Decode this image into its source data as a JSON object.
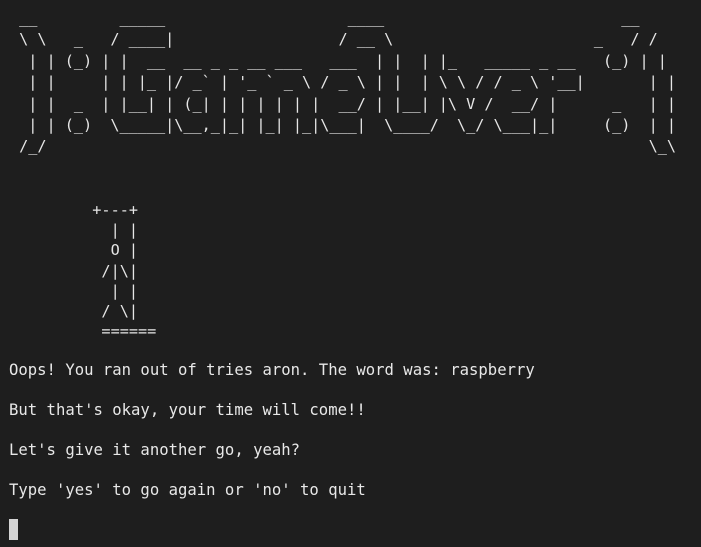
{
  "terminal": {
    "banner_art": " __         _____                    ____                          __\n \\ \\   _   / ____|                  / __ \\                      _   / /\n  | | (_) | |  __  __ _ _ __ ___   ___  | |  | |_   _____ _ __   (_) | |\n  | |     | | |_ |/ _` | '_ ` _ \\ / _ \\ | |  | \\ \\ / / _ \\ '__|       | |\n  | |  _  | |__| | (_| | | | | | |  __/ | |__| |\\ V /  __/ |      _   | |\n  | | (_)  \\_____|\\__,_|_| |_| |_|\\___|  \\____/  \\_/ \\___|_|     (_)  | |\n /_/                                                                  \\_\\",
    "gallows_art": "         +---+\n           | |\n           O |\n          /|\\|\n           | |\n          / \\|\n          ======",
    "lines": [
      "Oops! You ran out of tries aron. The word was: raspberry",
      "But that's okay, your time will come!!",
      "Let's give it another go, yeah?",
      "Type 'yes' to go again or 'no' to quit"
    ],
    "cursor_color": "#d4d4d4",
    "background_color": "#1e1e1e"
  }
}
